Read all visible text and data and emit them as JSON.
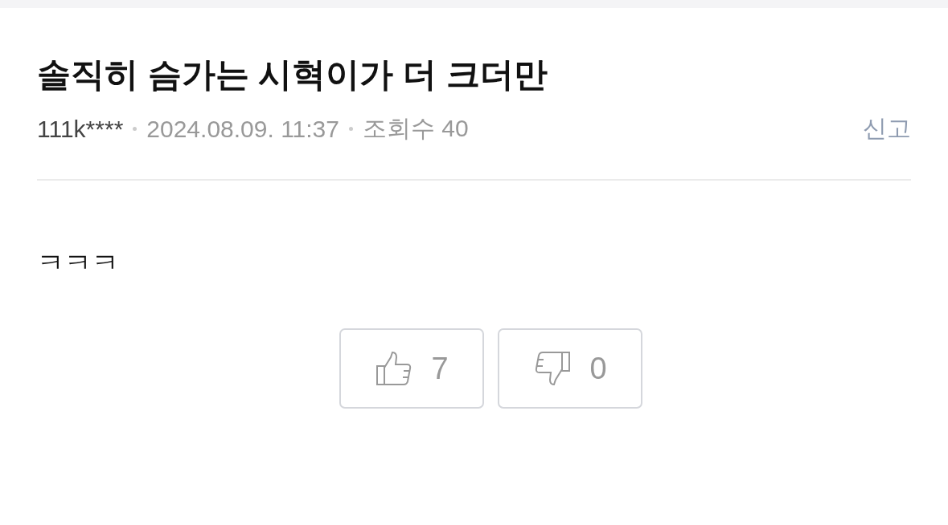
{
  "post": {
    "title": "솔직히 슴가는 시혁이가 더 크더만",
    "author": "111k****",
    "date": "2024.08.09. 11:37",
    "views": "조회수 40",
    "report": "신고",
    "body": "ㅋㅋㅋ"
  },
  "votes": [
    {
      "kind": "up",
      "count": "7"
    },
    {
      "kind": "down",
      "count": "0"
    }
  ]
}
